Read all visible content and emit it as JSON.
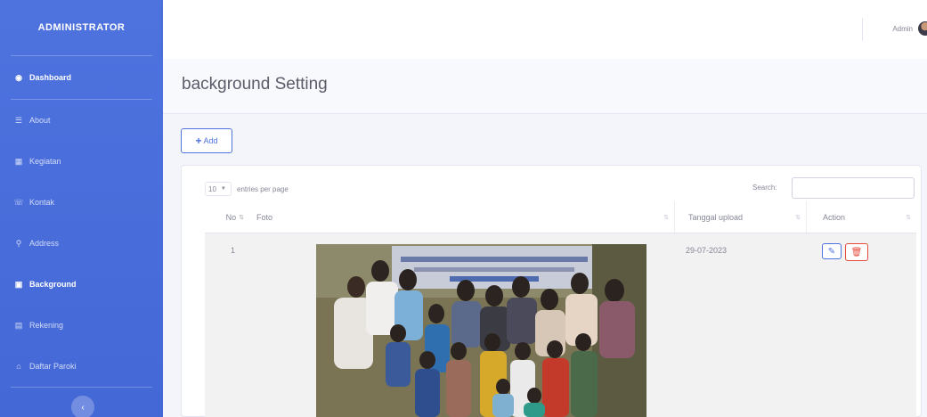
{
  "sidebar": {
    "brand": "ADMINISTRATOR",
    "dashboard": {
      "label": "Dashboard",
      "icon": "tachometer-icon"
    },
    "items": [
      {
        "label": "About",
        "icon": "list-icon"
      },
      {
        "label": "Kegiatan",
        "icon": "calendar-icon"
      },
      {
        "label": "Kontak",
        "icon": "phone-icon"
      },
      {
        "label": "Address",
        "icon": "map-marker-icon"
      },
      {
        "label": "Background",
        "icon": "image-icon"
      },
      {
        "label": "Rekening",
        "icon": "bank-icon"
      },
      {
        "label": "Daftar Paroki",
        "icon": "church-icon"
      }
    ],
    "toggle_icon": "chevron-left-icon"
  },
  "topbar": {
    "username": "Admin"
  },
  "page": {
    "title": "background Setting",
    "add_label": "Add"
  },
  "table": {
    "entries_value": "10",
    "entries_label": "entries per page",
    "search_label": "Search:",
    "search_value": "",
    "columns": [
      "No",
      "Foto",
      "Tanggal upload",
      "Action"
    ],
    "rows": [
      {
        "no": "1",
        "tanggal": "29-07-2023"
      }
    ]
  },
  "colors": {
    "sidebar": "#4e73df",
    "primary": "#4e73df",
    "danger": "#e74a3b"
  }
}
